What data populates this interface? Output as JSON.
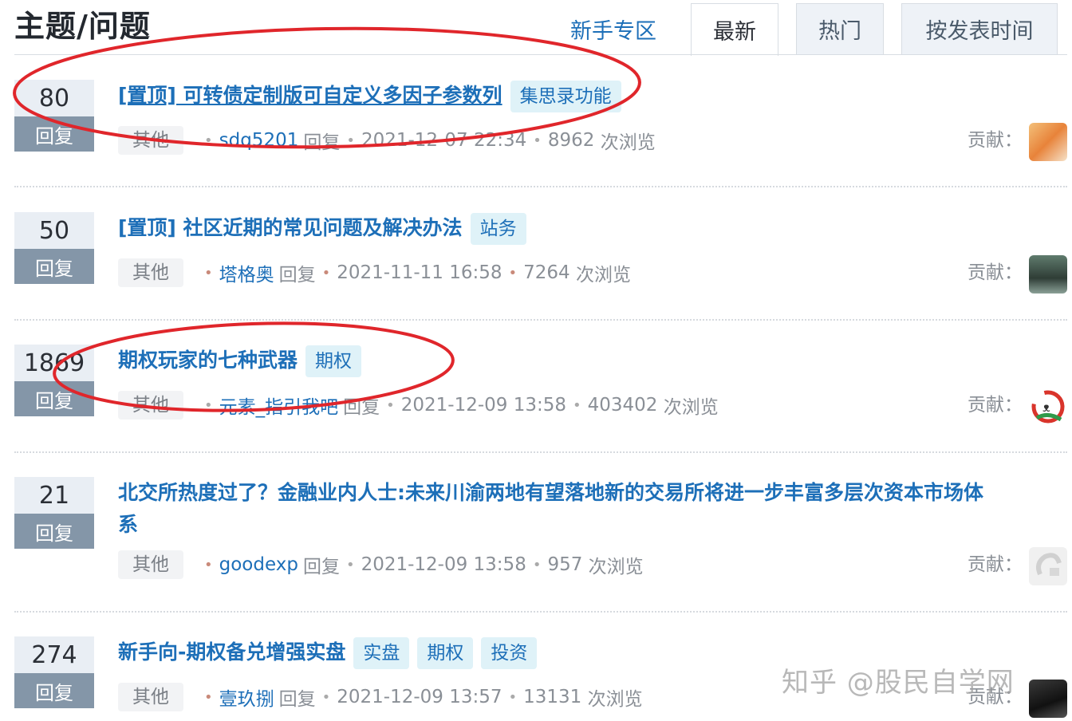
{
  "page_title": "主题/问题",
  "tabs": [
    {
      "label": "新手专区"
    },
    {
      "label": "最新"
    },
    {
      "label": "热门"
    },
    {
      "label": "按发表时间"
    }
  ],
  "reply_label": "回复",
  "contrib_label": "贡献：",
  "views_suffix": "次浏览",
  "topics": [
    {
      "count": "80",
      "title": "[置顶] 可转债定制版可自定义多因子参数列",
      "tags": [
        "集思录功能"
      ],
      "category": "其他",
      "user": "sdq5201",
      "action": "回复",
      "time": "2021-12-07 22:34",
      "views": "8962"
    },
    {
      "count": "50",
      "title": "[置顶] 社区近期的常见问题及解决办法",
      "tags": [
        "站务"
      ],
      "category": "其他",
      "user": "塔格奥",
      "action": "回复",
      "time": "2021-11-11 16:58",
      "views": "7264"
    },
    {
      "count": "1869",
      "title": "期权玩家的七种武器",
      "tags": [
        "期权"
      ],
      "category": "其他",
      "user": "元素_指引我吧",
      "action": "回复",
      "time": "2021-12-09 13:58",
      "views": "403402"
    },
    {
      "count": "21",
      "title": "北交所热度过了？金融业内人士:未来川渝两地有望落地新的交易所将进一步丰富多层次资本市场体系",
      "tags": [],
      "category": "其他",
      "user": "goodexp",
      "action": "回复",
      "time": "2021-12-09 13:58",
      "views": "957"
    },
    {
      "count": "274",
      "title": "新手向-期权备兑增强实盘",
      "tags": [
        "实盘",
        "期权",
        "投资"
      ],
      "category": "其他",
      "user": "壹玖捌",
      "action": "回复",
      "time": "2021-12-09 13:57",
      "views": "13131"
    }
  ],
  "watermark": "知乎 @股民自学网",
  "colors": {
    "link": "#1d6fb8",
    "tag_bg": "#dff2f8",
    "count_label_bg": "#8496a8",
    "annotation_red": "#e0262b"
  }
}
